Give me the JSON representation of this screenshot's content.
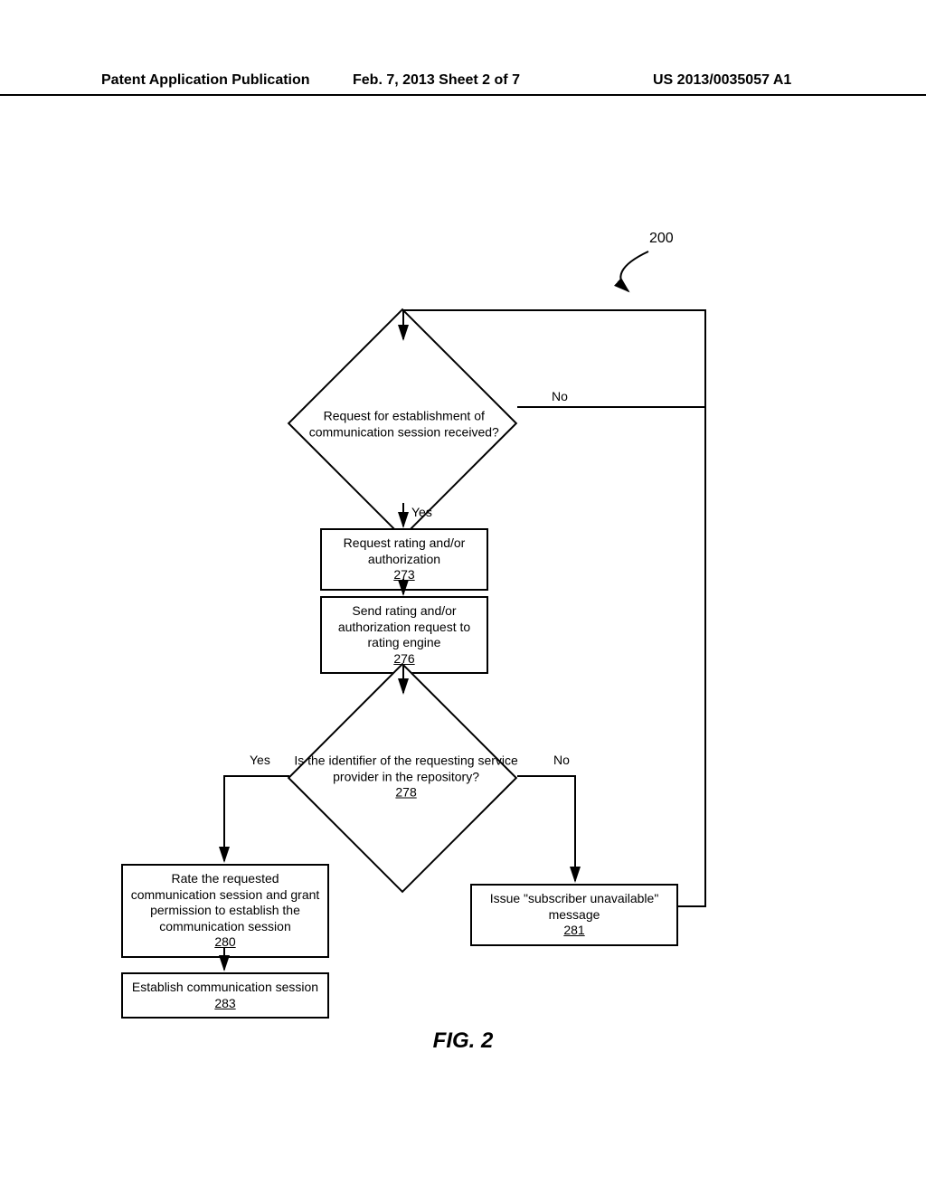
{
  "header": {
    "left": "Patent Application Publication",
    "mid": "Feb. 7, 2013  Sheet 2 of 7",
    "right": "US 2013/0035057 A1"
  },
  "figure_label": "FIG. 2",
  "ref_200": "200",
  "decision1": {
    "text": "Request for establishment of communication session received?",
    "yes": "Yes",
    "no": "No"
  },
  "box273": {
    "text": "Request rating and/or authorization",
    "ref": "273"
  },
  "box276": {
    "text": "Send rating and/or authorization request to rating engine",
    "ref": "276"
  },
  "decision2": {
    "text": "Is the identifier of the requesting service provider in the repository?",
    "ref": "278",
    "yes": "Yes",
    "no": "No"
  },
  "box280": {
    "text": "Rate the requested communication session and grant permission to establish the communication session",
    "ref": "280"
  },
  "box281": {
    "text": "Issue \"subscriber unavailable\" message",
    "ref": "281"
  },
  "box283": {
    "text": "Establish communication session",
    "ref": "283"
  }
}
